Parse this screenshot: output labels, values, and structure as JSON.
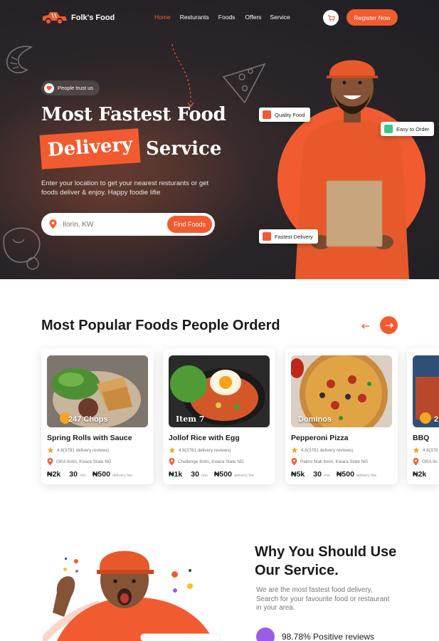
{
  "brand": {
    "name": "Folk's Food"
  },
  "nav": {
    "links": [
      "Home",
      "Resturants",
      "Foods",
      "Offers",
      "Service"
    ],
    "active": "Home",
    "register_label": "Register Now"
  },
  "hero": {
    "trust_badge": "People trust us",
    "headline_line1": "Most Fastest Food",
    "headline_highlight": "Delivery",
    "headline_line2_rest": "Service",
    "subtitle": "Enter your location to get your nearest resturants or get foods deliver & enjoy. Happy foodie lifie",
    "search": {
      "placeholder": "Ilorin, KW",
      "button_label": "Find Foods"
    },
    "badges": {
      "quality": "Quality Food",
      "easy": "Easy to Order",
      "fast": "Fastest Delivery"
    }
  },
  "popular": {
    "title": "Most Popular Foods People Orderd",
    "cards": [
      {
        "name": "Spring Rolls with Sauce",
        "image_label": "247 Chops",
        "rating": "4.8(3781 delivery reviews)",
        "location": "GRA Ilorin, Kwara State NG",
        "price": "₦2k",
        "time": "30",
        "time_unit": "min",
        "fee": "₦500",
        "fee_label": "delivery fee"
      },
      {
        "name": "Jollof Rice with Egg",
        "image_label": "Item 7",
        "rating": "4.8(3781 delivery reviews)",
        "location": "Challenge Ilorin, Kwara State NG",
        "price": "₦1k",
        "time": "30",
        "time_unit": "min",
        "fee": "₦500",
        "fee_label": "delivery fee"
      },
      {
        "name": "Pepperoni Pizza",
        "image_label": "Dominos",
        "rating": "4.8(3781 delivery reviews)",
        "location": "Palms Mall Ilorin, Kwara State NG",
        "price": "₦5k",
        "time": "30",
        "time_unit": "min",
        "fee": "₦500",
        "fee_label": "delivery fee"
      },
      {
        "name": "BBQ",
        "image_label": "2",
        "rating": "4.8(378",
        "location": "GRA Ilo",
        "price": "₦2k",
        "time": "",
        "time_unit": "",
        "fee": "",
        "fee_label": ""
      }
    ]
  },
  "why": {
    "title": "Why You Should Use Our Service.",
    "description": "We are the most fastest food delivery, Search for your favourite food or restaurant in your area.",
    "stat": "98.78% Positive reviews"
  },
  "colors": {
    "accent": "#f25b30",
    "hero_bg": "#25222a",
    "star": "#f5a623"
  }
}
